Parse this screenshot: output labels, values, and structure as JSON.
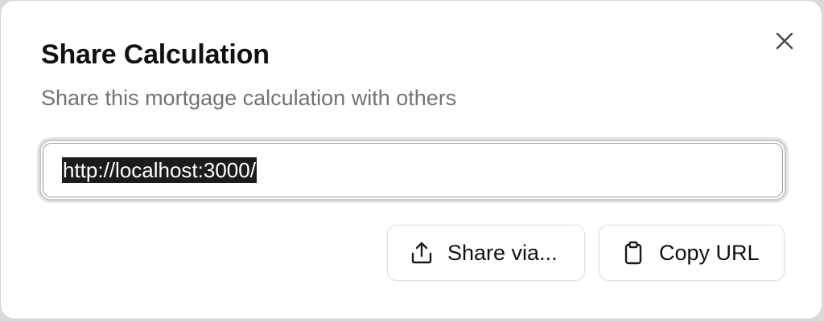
{
  "dialog": {
    "title": "Share Calculation",
    "subtitle": "Share this mortgage calculation with others",
    "close_icon": "close-icon"
  },
  "url_field": {
    "value": "http://localhost:3000/",
    "selected": true
  },
  "actions": {
    "share": {
      "label": "Share via...",
      "icon": "share-icon"
    },
    "copy": {
      "label": "Copy URL",
      "icon": "clipboard-icon"
    }
  },
  "colors": {
    "title": "#111111",
    "subtitle": "#737373",
    "selection_bg": "#1c1c1c",
    "selection_text": "#ffffff",
    "border": "#dedede"
  }
}
